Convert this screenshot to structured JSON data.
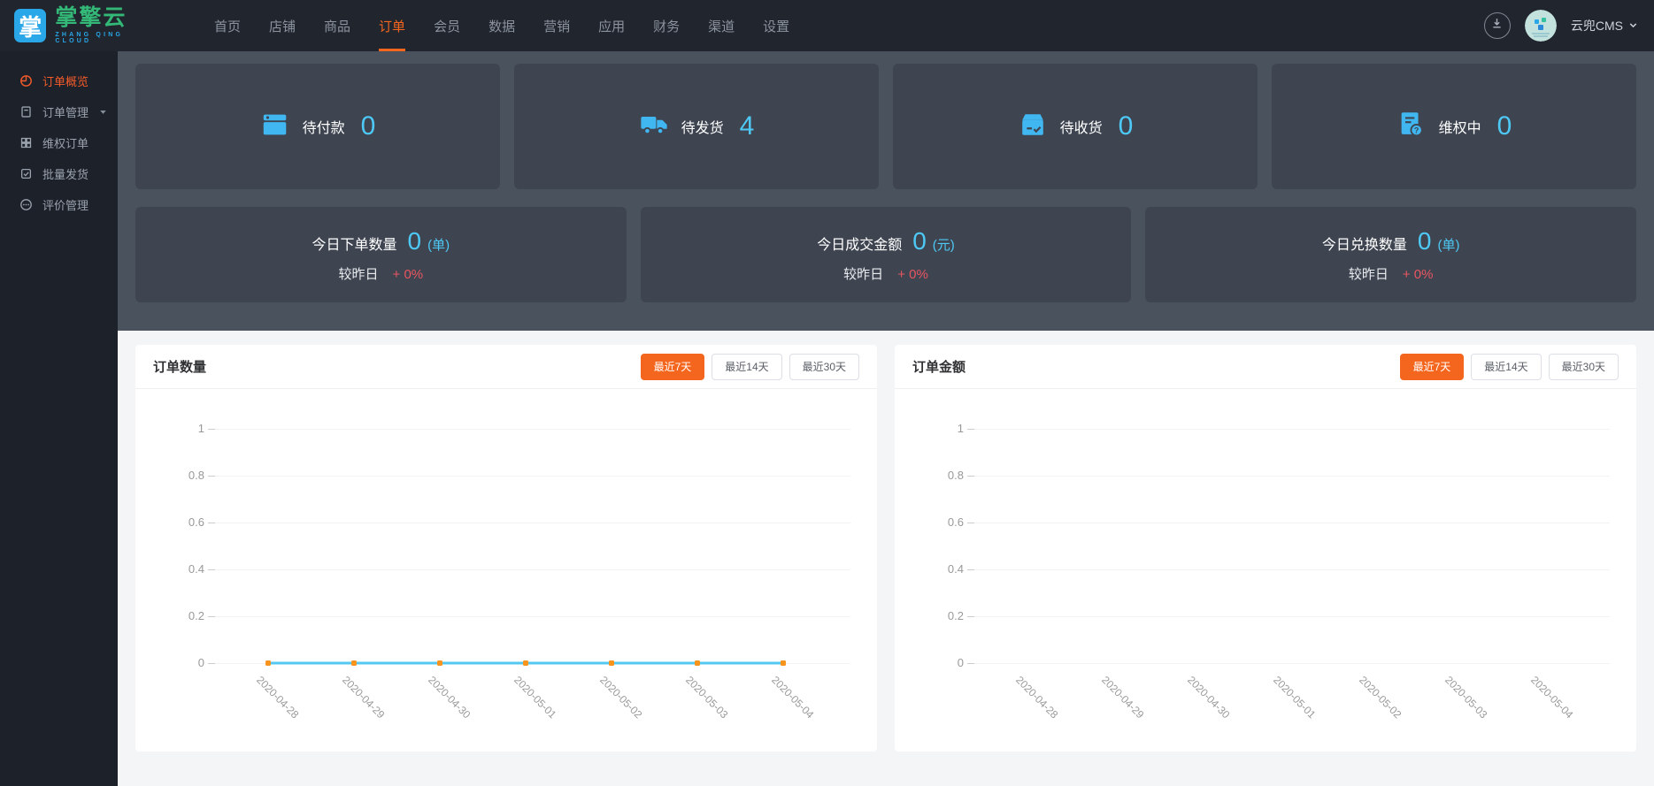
{
  "topbar": {
    "logo": {
      "square_char": "掌",
      "brand": "掌擎云",
      "subtitle": "ZHANG QING CLOUD"
    },
    "nav_items": [
      {
        "key": "home",
        "label": "首页"
      },
      {
        "key": "shop",
        "label": "店铺"
      },
      {
        "key": "goods",
        "label": "商品"
      },
      {
        "key": "orders",
        "label": "订单"
      },
      {
        "key": "members",
        "label": "会员"
      },
      {
        "key": "data",
        "label": "数据"
      },
      {
        "key": "marketing",
        "label": "营销"
      },
      {
        "key": "apps",
        "label": "应用"
      },
      {
        "key": "finance",
        "label": "财务"
      },
      {
        "key": "channels",
        "label": "渠道"
      },
      {
        "key": "settings",
        "label": "设置"
      }
    ],
    "active_nav": "订单",
    "user": {
      "name": "云兜CMS"
    }
  },
  "sidebar": {
    "items": [
      {
        "key": "order-overview",
        "label": "订单概览",
        "icon": "pie-chart-icon",
        "active": true
      },
      {
        "key": "order-management",
        "label": "订单管理",
        "icon": "document-icon",
        "expandable": true
      },
      {
        "key": "dispute-orders",
        "label": "维权订单",
        "icon": "grid-icon"
      },
      {
        "key": "batch-shipping",
        "label": "批量发货",
        "icon": "checkbox-icon"
      },
      {
        "key": "review-management",
        "label": "评价管理",
        "icon": "comment-icon"
      }
    ]
  },
  "stats": {
    "cards": [
      {
        "key": "pending-payment",
        "label": "待付款",
        "value": "0",
        "icon": "wallet-icon"
      },
      {
        "key": "pending-shipment",
        "label": "待发货",
        "value": "4",
        "icon": "truck-icon"
      },
      {
        "key": "pending-receipt",
        "label": "待收货",
        "value": "0",
        "icon": "box-check-icon"
      },
      {
        "key": "in-dispute",
        "label": "维权中",
        "value": "0",
        "icon": "document-question-icon"
      }
    ]
  },
  "summary": {
    "cards": [
      {
        "key": "today-orders",
        "label": "今日下单数量",
        "value": "0",
        "unit": "(单)",
        "compare_label": "较昨日",
        "change": "+ 0%"
      },
      {
        "key": "today-revenue",
        "label": "今日成交金额",
        "value": "0",
        "unit": "(元)",
        "compare_label": "较昨日",
        "change": "+ 0%"
      },
      {
        "key": "today-exchanges",
        "label": "今日兑换数量",
        "value": "0",
        "unit": "(单)",
        "compare_label": "较昨日",
        "change": "+ 0%"
      }
    ]
  },
  "chart_data": [
    {
      "type": "line",
      "title": "订单数量",
      "categories": [
        "2020-04-28",
        "2020-04-29",
        "2020-04-30",
        "2020-05-01",
        "2020-05-02",
        "2020-05-03",
        "2020-05-04"
      ],
      "series": [
        {
          "name": "订单数量",
          "values": [
            0,
            0,
            0,
            0,
            0,
            0,
            0
          ]
        }
      ],
      "ylim": [
        0,
        1
      ],
      "yticks": [
        1,
        0.8,
        0.6,
        0.4,
        0.2,
        0
      ],
      "grid": true,
      "legend_position": "none",
      "filters": [
        "最近7天",
        "最近14天",
        "最近30天"
      ],
      "active_filter": "最近7天"
    },
    {
      "type": "line",
      "title": "订单金额",
      "categories": [
        "2020-04-28",
        "2020-04-29",
        "2020-04-30",
        "2020-05-01",
        "2020-05-02",
        "2020-05-03",
        "2020-05-04"
      ],
      "series": [],
      "ylim": [
        0,
        1
      ],
      "yticks": [
        1,
        0.8,
        0.6,
        0.4,
        0.2,
        0
      ],
      "grid": true,
      "legend_position": "none",
      "filters": [
        "最近7天",
        "最近14天",
        "最近30天"
      ],
      "active_filter": "最近7天"
    }
  ],
  "colors": {
    "accent_orange": "#f4661e",
    "number_cyan": "#4ec9f5",
    "icon_blue": "#41b7f2",
    "change_red": "#e85560",
    "line_cyan": "#54c8f0",
    "marker_orange": "#f6941d"
  }
}
